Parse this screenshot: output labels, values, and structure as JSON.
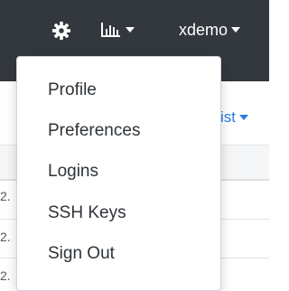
{
  "topbar": {
    "settings_icon": "gear-icon",
    "stats_icon": "bar-chart-icon",
    "username": "xdemo"
  },
  "toolbar": {
    "list_label_fragment": "ist"
  },
  "table": {
    "row_fragments": [
      "2.",
      "2.",
      "2."
    ]
  },
  "user_menu": {
    "items": [
      {
        "label": "Profile"
      },
      {
        "label": "Preferences"
      },
      {
        "label": "Logins"
      },
      {
        "label": "SSH Keys"
      },
      {
        "label": "Sign Out"
      }
    ]
  },
  "colors": {
    "topbar_bg": "#33383f",
    "link_blue": "#2a7ae2",
    "menu_text": "#2e3338"
  }
}
